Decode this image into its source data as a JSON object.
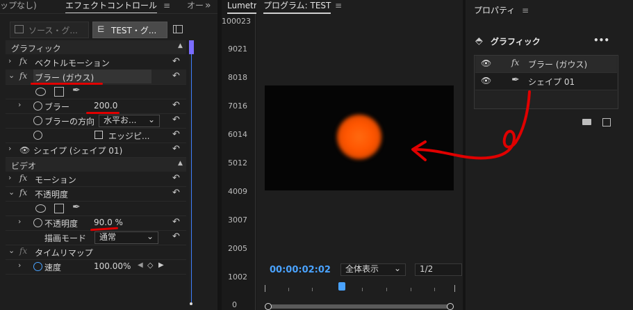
{
  "effect_panel": {
    "tab_prev": "ップなし)",
    "tab_active": "エフェクトコントロール",
    "tab_next": "オー",
    "more_tabs": "»",
    "source_tab": "ソース・グ...",
    "sequence_tab": "TEST・グ..."
  },
  "sections": {
    "graphic": "グラフィック",
    "video": "ビデオ"
  },
  "graphic_rows": {
    "vector_motion": "ベクトルモーション",
    "blur_gauss": "ブラー (ガウス)",
    "blur": "ブラー",
    "blur_value": "200.0",
    "blur_direction": "ブラーの方向",
    "blur_direction_value": "水平お...",
    "edge": "エッジピ...",
    "shape": "シェイプ (シェイプ 01)"
  },
  "video_rows": {
    "motion": "モーション",
    "opacity_group": "不透明度",
    "opacity": "不透明度",
    "opacity_value": "90.0 %",
    "blend_mode": "描画モード",
    "blend_mode_value": "通常",
    "time_remap": "タイムリマップ",
    "speed": "速度",
    "speed_value": "100.00%"
  },
  "lumetri": {
    "tab": "Lumetri",
    "scale": [
      "100023",
      "9021",
      "8018",
      "7016",
      "6014",
      "5012",
      "4009",
      "3007",
      "2005",
      "1002",
      "0"
    ]
  },
  "program": {
    "title": "プログラム: TEST",
    "timecode": "00:00:02:02",
    "zoom": "全体表示",
    "resolution": "1/2"
  },
  "properties": {
    "title": "プロパティ",
    "graphic_label": "グラフィック",
    "more": "•••",
    "layer_blur": "ブラー (ガウス)",
    "layer_shape": "シェイプ 01"
  },
  "colors": {
    "accent_blue": "#4aa3ff",
    "annotation_red": "#e00000",
    "orb_orange": "#ff5a00"
  }
}
